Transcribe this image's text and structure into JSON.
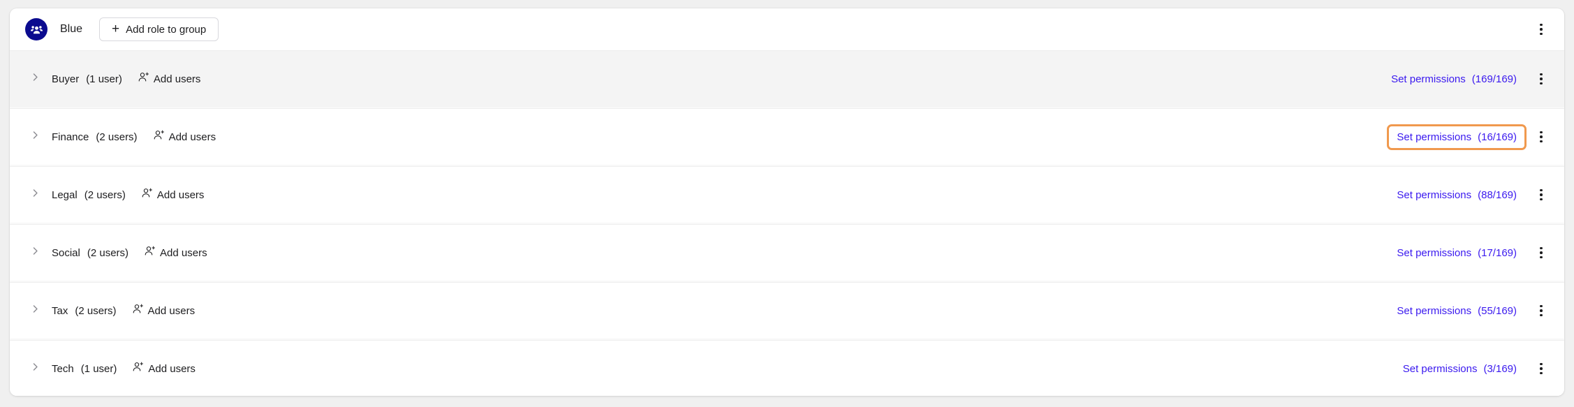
{
  "header": {
    "avatar_icon": "group-people-icon",
    "avatar_color": "#0B0B8F",
    "group_name": "Blue",
    "add_role_button": {
      "label": "Add role to group",
      "icon": "plus-icon"
    },
    "overflow_menu_icon": "kebab-menu-icon"
  },
  "colors": {
    "link": "#3A19EF",
    "focus_outline": "#F0994E",
    "row_shaded_bg": "#F4F4F4",
    "page_bg": "#F0F0F0"
  },
  "rows": [
    {
      "role": "Buyer",
      "user_count": "(1 user)",
      "add_users_label": "Add users",
      "add_users_icon": "person-add-icon",
      "chevron_icon": "chevron-right-icon",
      "permissions_label": "Set permissions",
      "permissions_count": "(169/169)",
      "menu_icon": "kebab-menu-icon",
      "shaded": true,
      "focused": false
    },
    {
      "role": "Finance",
      "user_count": "(2 users)",
      "add_users_label": "Add users",
      "add_users_icon": "person-add-icon",
      "chevron_icon": "chevron-right-icon",
      "permissions_label": "Set permissions",
      "permissions_count": "(16/169)",
      "menu_icon": "kebab-menu-icon",
      "shaded": false,
      "focused": true
    },
    {
      "role": "Legal",
      "user_count": "(2 users)",
      "add_users_label": "Add users",
      "add_users_icon": "person-add-icon",
      "chevron_icon": "chevron-right-icon",
      "permissions_label": "Set permissions",
      "permissions_count": "(88/169)",
      "menu_icon": "kebab-menu-icon",
      "shaded": false,
      "focused": false
    },
    {
      "role": "Social",
      "user_count": "(2 users)",
      "add_users_label": "Add users",
      "add_users_icon": "person-add-icon",
      "chevron_icon": "chevron-right-icon",
      "permissions_label": "Set permissions",
      "permissions_count": "(17/169)",
      "menu_icon": "kebab-menu-icon",
      "shaded": false,
      "focused": false
    },
    {
      "role": "Tax",
      "user_count": "(2 users)",
      "add_users_label": "Add users",
      "add_users_icon": "person-add-icon",
      "chevron_icon": "chevron-right-icon",
      "permissions_label": "Set permissions",
      "permissions_count": "(55/169)",
      "menu_icon": "kebab-menu-icon",
      "shaded": false,
      "focused": false
    },
    {
      "role": "Tech",
      "user_count": "(1 user)",
      "add_users_label": "Add users",
      "add_users_icon": "person-add-icon",
      "chevron_icon": "chevron-right-icon",
      "permissions_label": "Set permissions",
      "permissions_count": "(3/169)",
      "menu_icon": "kebab-menu-icon",
      "shaded": false,
      "focused": false
    }
  ]
}
